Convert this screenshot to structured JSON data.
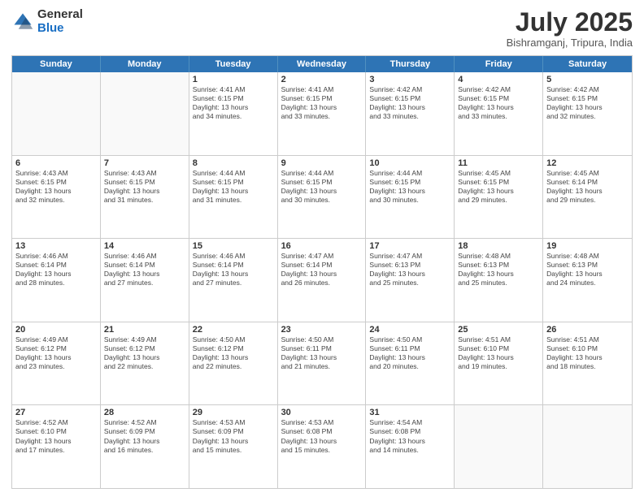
{
  "header": {
    "logo_general": "General",
    "logo_blue": "Blue",
    "month_title": "July 2025",
    "subtitle": "Bishramganj, Tripura, India"
  },
  "weekdays": [
    "Sunday",
    "Monday",
    "Tuesday",
    "Wednesday",
    "Thursday",
    "Friday",
    "Saturday"
  ],
  "rows": [
    [
      {
        "day": "",
        "text": ""
      },
      {
        "day": "",
        "text": ""
      },
      {
        "day": "1",
        "text": "Sunrise: 4:41 AM\nSunset: 6:15 PM\nDaylight: 13 hours\nand 34 minutes."
      },
      {
        "day": "2",
        "text": "Sunrise: 4:41 AM\nSunset: 6:15 PM\nDaylight: 13 hours\nand 33 minutes."
      },
      {
        "day": "3",
        "text": "Sunrise: 4:42 AM\nSunset: 6:15 PM\nDaylight: 13 hours\nand 33 minutes."
      },
      {
        "day": "4",
        "text": "Sunrise: 4:42 AM\nSunset: 6:15 PM\nDaylight: 13 hours\nand 33 minutes."
      },
      {
        "day": "5",
        "text": "Sunrise: 4:42 AM\nSunset: 6:15 PM\nDaylight: 13 hours\nand 32 minutes."
      }
    ],
    [
      {
        "day": "6",
        "text": "Sunrise: 4:43 AM\nSunset: 6:15 PM\nDaylight: 13 hours\nand 32 minutes."
      },
      {
        "day": "7",
        "text": "Sunrise: 4:43 AM\nSunset: 6:15 PM\nDaylight: 13 hours\nand 31 minutes."
      },
      {
        "day": "8",
        "text": "Sunrise: 4:44 AM\nSunset: 6:15 PM\nDaylight: 13 hours\nand 31 minutes."
      },
      {
        "day": "9",
        "text": "Sunrise: 4:44 AM\nSunset: 6:15 PM\nDaylight: 13 hours\nand 30 minutes."
      },
      {
        "day": "10",
        "text": "Sunrise: 4:44 AM\nSunset: 6:15 PM\nDaylight: 13 hours\nand 30 minutes."
      },
      {
        "day": "11",
        "text": "Sunrise: 4:45 AM\nSunset: 6:15 PM\nDaylight: 13 hours\nand 29 minutes."
      },
      {
        "day": "12",
        "text": "Sunrise: 4:45 AM\nSunset: 6:14 PM\nDaylight: 13 hours\nand 29 minutes."
      }
    ],
    [
      {
        "day": "13",
        "text": "Sunrise: 4:46 AM\nSunset: 6:14 PM\nDaylight: 13 hours\nand 28 minutes."
      },
      {
        "day": "14",
        "text": "Sunrise: 4:46 AM\nSunset: 6:14 PM\nDaylight: 13 hours\nand 27 minutes."
      },
      {
        "day": "15",
        "text": "Sunrise: 4:46 AM\nSunset: 6:14 PM\nDaylight: 13 hours\nand 27 minutes."
      },
      {
        "day": "16",
        "text": "Sunrise: 4:47 AM\nSunset: 6:14 PM\nDaylight: 13 hours\nand 26 minutes."
      },
      {
        "day": "17",
        "text": "Sunrise: 4:47 AM\nSunset: 6:13 PM\nDaylight: 13 hours\nand 25 minutes."
      },
      {
        "day": "18",
        "text": "Sunrise: 4:48 AM\nSunset: 6:13 PM\nDaylight: 13 hours\nand 25 minutes."
      },
      {
        "day": "19",
        "text": "Sunrise: 4:48 AM\nSunset: 6:13 PM\nDaylight: 13 hours\nand 24 minutes."
      }
    ],
    [
      {
        "day": "20",
        "text": "Sunrise: 4:49 AM\nSunset: 6:12 PM\nDaylight: 13 hours\nand 23 minutes."
      },
      {
        "day": "21",
        "text": "Sunrise: 4:49 AM\nSunset: 6:12 PM\nDaylight: 13 hours\nand 22 minutes."
      },
      {
        "day": "22",
        "text": "Sunrise: 4:50 AM\nSunset: 6:12 PM\nDaylight: 13 hours\nand 22 minutes."
      },
      {
        "day": "23",
        "text": "Sunrise: 4:50 AM\nSunset: 6:11 PM\nDaylight: 13 hours\nand 21 minutes."
      },
      {
        "day": "24",
        "text": "Sunrise: 4:50 AM\nSunset: 6:11 PM\nDaylight: 13 hours\nand 20 minutes."
      },
      {
        "day": "25",
        "text": "Sunrise: 4:51 AM\nSunset: 6:10 PM\nDaylight: 13 hours\nand 19 minutes."
      },
      {
        "day": "26",
        "text": "Sunrise: 4:51 AM\nSunset: 6:10 PM\nDaylight: 13 hours\nand 18 minutes."
      }
    ],
    [
      {
        "day": "27",
        "text": "Sunrise: 4:52 AM\nSunset: 6:10 PM\nDaylight: 13 hours\nand 17 minutes."
      },
      {
        "day": "28",
        "text": "Sunrise: 4:52 AM\nSunset: 6:09 PM\nDaylight: 13 hours\nand 16 minutes."
      },
      {
        "day": "29",
        "text": "Sunrise: 4:53 AM\nSunset: 6:09 PM\nDaylight: 13 hours\nand 15 minutes."
      },
      {
        "day": "30",
        "text": "Sunrise: 4:53 AM\nSunset: 6:08 PM\nDaylight: 13 hours\nand 15 minutes."
      },
      {
        "day": "31",
        "text": "Sunrise: 4:54 AM\nSunset: 6:08 PM\nDaylight: 13 hours\nand 14 minutes."
      },
      {
        "day": "",
        "text": ""
      },
      {
        "day": "",
        "text": ""
      }
    ]
  ]
}
